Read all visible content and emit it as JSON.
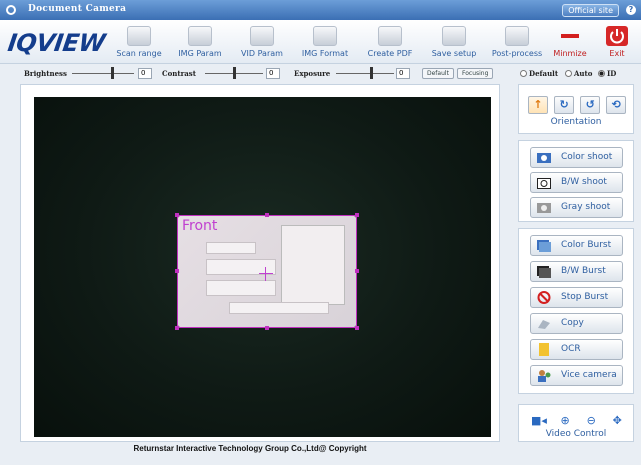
{
  "window": {
    "title": "Document Camera",
    "official_site": "Official site"
  },
  "brand": {
    "logo": "IQVIEW"
  },
  "toolbar": {
    "buttons": [
      {
        "label": "Scan range",
        "icon": "scan-range-icon"
      },
      {
        "label": "IMG Param",
        "icon": "tools-icon"
      },
      {
        "label": "VID Param",
        "icon": "video-param-icon"
      },
      {
        "label": "IMG Format",
        "icon": "image-format-icon"
      },
      {
        "label": "Create PDF",
        "icon": "pdf-icon"
      },
      {
        "label": "Save setup",
        "icon": "pencil-icon"
      },
      {
        "label": "Post-process",
        "icon": "post-process-icon"
      },
      {
        "label": "Minmize",
        "icon": "minimize-icon"
      },
      {
        "label": "Exit",
        "icon": "power-icon"
      }
    ]
  },
  "sliders": {
    "brightness": {
      "label": "Brightness",
      "value": "0",
      "level": 0.5
    },
    "contrast": {
      "label": "Contrast",
      "value": "0",
      "level": 0.5
    },
    "exposure": {
      "label": "Exposure",
      "value": "0",
      "level": 0.5
    },
    "default_btn": "Default",
    "focusing_btn": "Focusing"
  },
  "mode": {
    "options": [
      "Default",
      "Auto",
      "ID"
    ],
    "selected": "ID"
  },
  "preview": {
    "overlay_label": "Front"
  },
  "orientation": {
    "title": "Orientation"
  },
  "shoot": {
    "buttons": [
      {
        "label": "Color shoot",
        "icon": "color-camera-icon"
      },
      {
        "label": "B/W shoot",
        "icon": "bw-camera-icon"
      },
      {
        "label": "Gray shoot",
        "icon": "gray-camera-icon"
      }
    ]
  },
  "burst": {
    "buttons": [
      {
        "label": "Color Burst",
        "icon": "color-burst-icon"
      },
      {
        "label": "B/W Burst",
        "icon": "bw-burst-icon"
      },
      {
        "label": "Stop Burst",
        "icon": "stop-icon"
      },
      {
        "label": "Copy",
        "icon": "copy-icon"
      },
      {
        "label": "OCR",
        "icon": "ocr-icon"
      },
      {
        "label": "Vice camera",
        "icon": "vice-camera-icon"
      }
    ]
  },
  "video_control": {
    "title": "Video Control"
  },
  "footer": {
    "copyright": "Returnstar Interactive Technology Group Co.,Ltd@ Copyright"
  }
}
